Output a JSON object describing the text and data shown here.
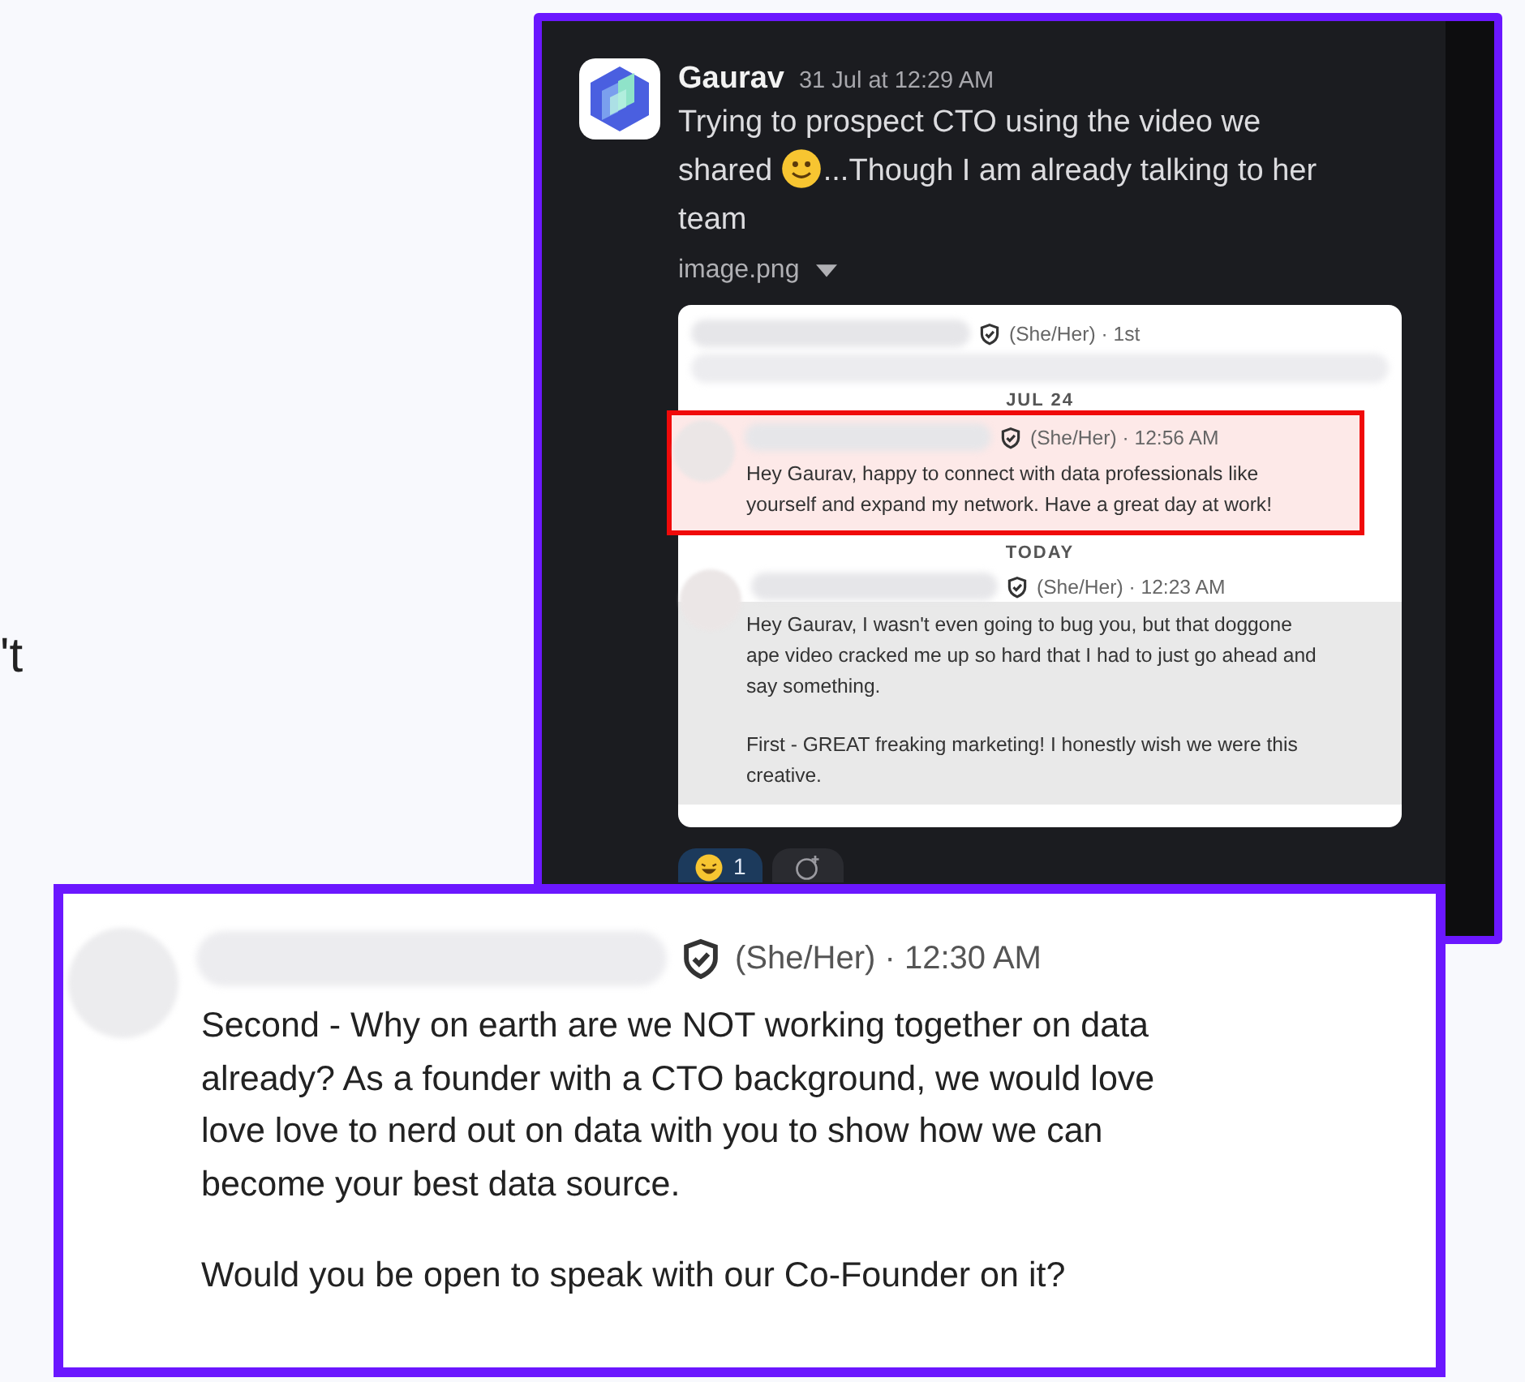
{
  "page_fragment": "'t",
  "slack_message": {
    "author": "Gaurav",
    "timestamp": "31 Jul at 12:29 AM",
    "text_before": "Trying to prospect CTO using the video we shared",
    "text_after": "...Though I am already talking to her team",
    "attachment": {
      "file_name": "image.png"
    },
    "reactions": [
      {
        "kind": "emoji",
        "count": "1",
        "selected": true
      },
      {
        "kind": "add"
      }
    ]
  },
  "linkedin_thread": [
    {
      "kind": "header",
      "meta": "(She/Her) · 1st"
    },
    {
      "kind": "divider",
      "label": "JUL 24"
    },
    {
      "kind": "message",
      "meta": "(She/Her) · 12:56 AM",
      "highlighted": true,
      "paragraphs": [
        "Hey Gaurav, happy to connect with data professionals like yourself and expand my network. Have a great day at work!"
      ]
    },
    {
      "kind": "divider",
      "label": "TODAY"
    },
    {
      "kind": "message",
      "meta": "(She/Her) · 12:23 AM",
      "highlighted": false,
      "paragraphs": [
        "Hey Gaurav, I wasn't even going to bug you, but that doggone ape video cracked me up so hard that I had to just go ahead and say something.",
        "First - GREAT freaking marketing! I honestly wish we were this creative."
      ]
    }
  ],
  "zoomed_message": {
    "meta": "(She/Her) · 12:30 AM",
    "paragraphs": [
      "Second - Why on earth are we NOT working together on data already? As a founder with a CTO background, we would love love love to nerd out on data with you to show how we can become your best data source.",
      "Would you be open to speak with our Co-Founder on it?"
    ]
  }
}
